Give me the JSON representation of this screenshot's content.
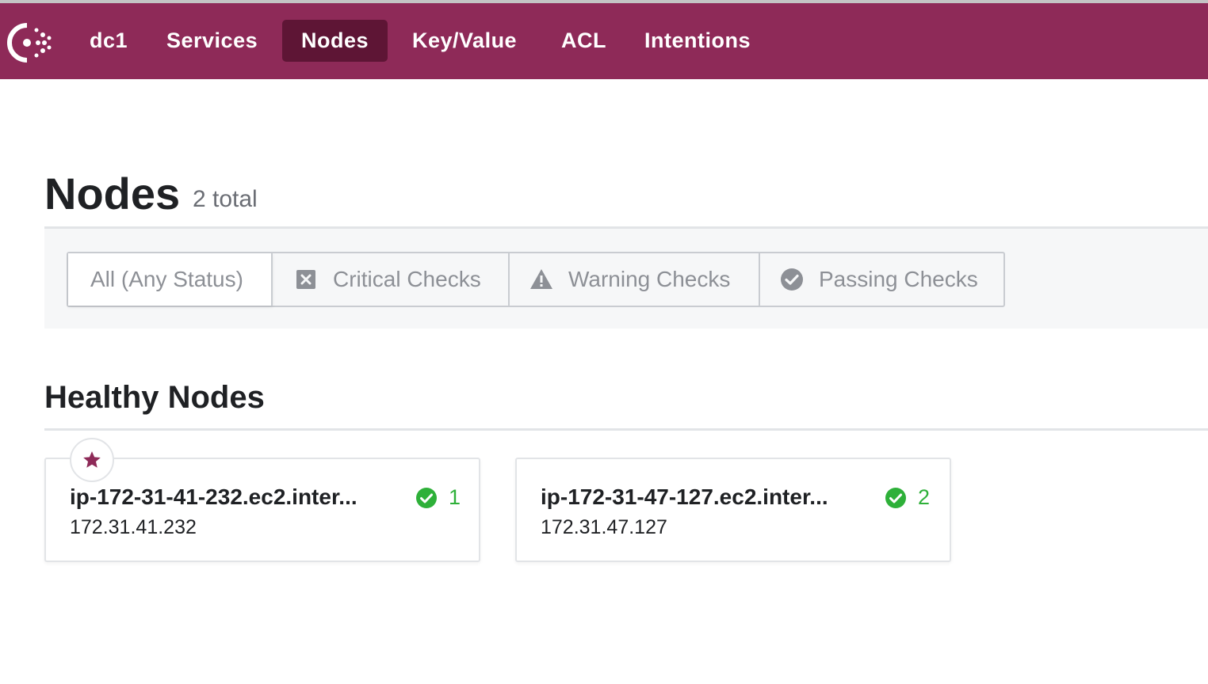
{
  "nav": {
    "logo_icon": "consul-logo-icon",
    "datacenter": "dc1",
    "items": [
      {
        "label": "Services"
      },
      {
        "label": "Nodes",
        "active": true
      },
      {
        "label": "Key/Value"
      },
      {
        "label": "ACL"
      },
      {
        "label": "Intentions"
      }
    ],
    "background_color": "#8e2a58",
    "active_color": "#5e1535"
  },
  "page": {
    "title": "Nodes",
    "total": "2 total"
  },
  "filters": [
    {
      "label": "All (Any Status)",
      "selected": true,
      "icon": ""
    },
    {
      "label": "Critical Checks",
      "icon": "critical-x-icon"
    },
    {
      "label": "Warning Checks",
      "icon": "warning-triangle-icon"
    },
    {
      "label": "Passing Checks",
      "icon": "passing-check-icon"
    }
  ],
  "section": {
    "title": "Healthy Nodes"
  },
  "nodes": [
    {
      "name": "ip-172-31-41-232.ec2.inter...",
      "ip": "172.31.41.232",
      "checks": "1",
      "leader": true
    },
    {
      "name": "ip-172-31-47-127.ec2.inter...",
      "ip": "172.31.47.127",
      "checks": "2",
      "leader": false
    }
  ],
  "colors": {
    "passing": "#2eb039",
    "brand": "#8e2a58"
  }
}
